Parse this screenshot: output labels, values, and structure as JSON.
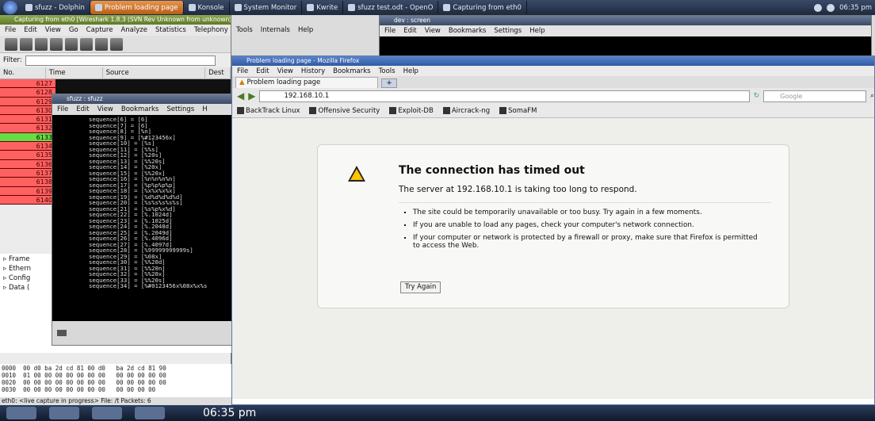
{
  "taskbar": {
    "items": [
      {
        "label": "sfuzz - Dolphin"
      },
      {
        "label": "Problem loading page",
        "active": true
      },
      {
        "label": "Konsole"
      },
      {
        "label": "System Monitor"
      },
      {
        "label": "Kwrite"
      },
      {
        "label": "sfuzz test.odt - OpenO"
      },
      {
        "label": "Capturing from eth0"
      }
    ],
    "clock": "06:35 pm",
    "accent": "#b75e19"
  },
  "wireshark": {
    "title": "Capturing from eth0   [Wireshark 1.8.3  (SVN Rev Unknown from unknown)]",
    "menu": [
      "File",
      "Edit",
      "View",
      "Go",
      "Capture",
      "Analyze",
      "Statistics",
      "Telephony",
      "Tools",
      "Internals",
      "Help"
    ],
    "filter_label": "Filter:",
    "columns": [
      "No.",
      "Time",
      "Source",
      "Dest"
    ],
    "rows": [
      "6127",
      "6128",
      "6129",
      "6130",
      "6131",
      "6132",
      "6133",
      "6134",
      "6135",
      "6136",
      "6137",
      "6138",
      "6139",
      "6140",
      "6141",
      "6142",
      "6143"
    ],
    "selected_row": "6133",
    "details": [
      "Frame",
      "Ethern",
      "Config",
      "Data ("
    ],
    "hex": [
      "0000  00 d0 ba 2d cd 81 00 d0   ba 2d cd 81 90",
      "0010  01 00 00 00 00 00 00 00   00 00 00 00 00",
      "0020  00 00 00 00 00 00 00 00   00 00 00 00 00",
      "0030  00 00 00 00 00 00 00 00   00 00 00 00"
    ],
    "status": "eth0: <live capture in progress> File: /t  Packets: 6"
  },
  "konsole": {
    "title": "sfuzz : sfuzz",
    "menu": [
      "File",
      "Edit",
      "View",
      "Bookmarks",
      "Settings",
      "H"
    ],
    "lines": [
      "sequence[6] = [6]",
      "sequence[7] = [6]",
      "sequence[8] = [%n]",
      "sequence[9] = [%#123456x]",
      "sequence[10] = [%s]",
      "sequence[11] = [%%s]",
      "sequence[12] = [%20s]",
      "sequence[13] = [%%20s]",
      "sequence[14] = [%20x]",
      "sequence[15] = [%%20x]",
      "sequence[16] = [%n%n%n%n]",
      "sequence[17] = [%p%p%p%p]",
      "sequence[18] = [%x%x%x%x]",
      "sequence[19] = [%d%d%d%d%d]",
      "sequence[20] = [%s%s%s%s%s]",
      "sequence[21] = [%s%p%x%d]",
      "sequence[22] = [%.1024d]",
      "sequence[23] = [%.1025d]",
      "sequence[24] = [%.2048d]",
      "sequence[25] = [%.2049d]",
      "sequence[26] = [%.4096d]",
      "sequence[27] = [%.4097d]",
      "sequence[28] = [%99999999999s]",
      "sequence[29] = [%08x]",
      "sequence[30] = [%%20d]",
      "sequence[31] = [%%20n]",
      "sequence[32] = [%%20x]",
      "sequence[33] = [%%20s]",
      "sequence[34] = [%#0123456x%08x%x%s"
    ]
  },
  "dev": {
    "title": "dev : screen",
    "menu": [
      "File",
      "Edit",
      "View",
      "Bookmarks",
      "Settings",
      "Help"
    ]
  },
  "firefox": {
    "title": "Problem loading page - Mozilla Firefox",
    "menu": [
      "File",
      "Edit",
      "View",
      "History",
      "Bookmarks",
      "Tools",
      "Help"
    ],
    "tab_label": "Problem loading page",
    "url": "192.168.10.1",
    "search_placeholder": "Google",
    "bookmarks": [
      "BackTrack Linux",
      "Offensive Security",
      "Exploit-DB",
      "Aircrack-ng",
      "SomaFM"
    ],
    "error_title": "The connection has timed out",
    "error_subtitle": "The server at 192.168.10.1 is taking too long to respond.",
    "bullets": [
      "The site could be temporarily unavailable or too busy. Try again in a few moments.",
      "If you are unable to load any pages, check your computer's network connection.",
      "If your computer or network is protected by a firewall or proxy, make sure that Firefox is permitted to access the Web."
    ],
    "try_again": "Try Again"
  }
}
